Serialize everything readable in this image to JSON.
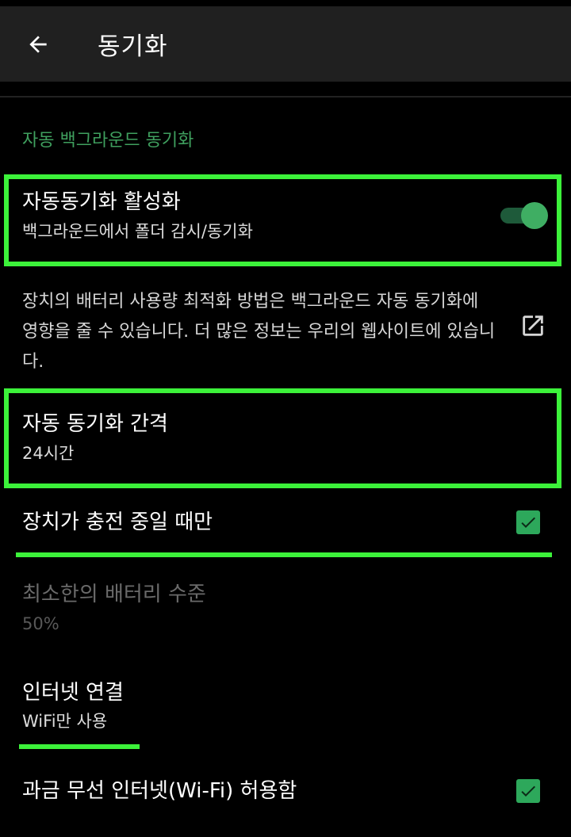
{
  "appbar": {
    "title": "동기화",
    "back_icon": "arrow-back-icon"
  },
  "section": {
    "header": "자동 백그라운드 동기화"
  },
  "auto_sync": {
    "title": "자동동기화 활성화",
    "summary": "백그라운드에서 폴더 감시/동기화",
    "enabled": true
  },
  "battery_info": {
    "text": "장치의 배터리 사용량 최적화 방법은 백그라운드 자동 동기화에 영향을 줄 수 있습니다. 더 많은 정보는 우리의 웹사이트에 있습니다.",
    "icon": "open-external-icon"
  },
  "sync_interval": {
    "title": "자동 동기화 간격",
    "summary": "24시간"
  },
  "charging_only": {
    "title": "장치가 충전 중일 때만",
    "checked": true
  },
  "min_battery": {
    "title": "최소한의 배터리 수준",
    "summary": "50%",
    "disabled": true
  },
  "internet": {
    "title": "인터넷 연결",
    "summary": "WiFi만 사용"
  },
  "metered_wifi": {
    "title": "과금 무선 인터넷(Wi-Fi) 허용함",
    "checked": true
  },
  "colors": {
    "accent": "#3fae63",
    "highlight": "#3cf23a",
    "background": "#000000",
    "appbar": "#202020"
  }
}
